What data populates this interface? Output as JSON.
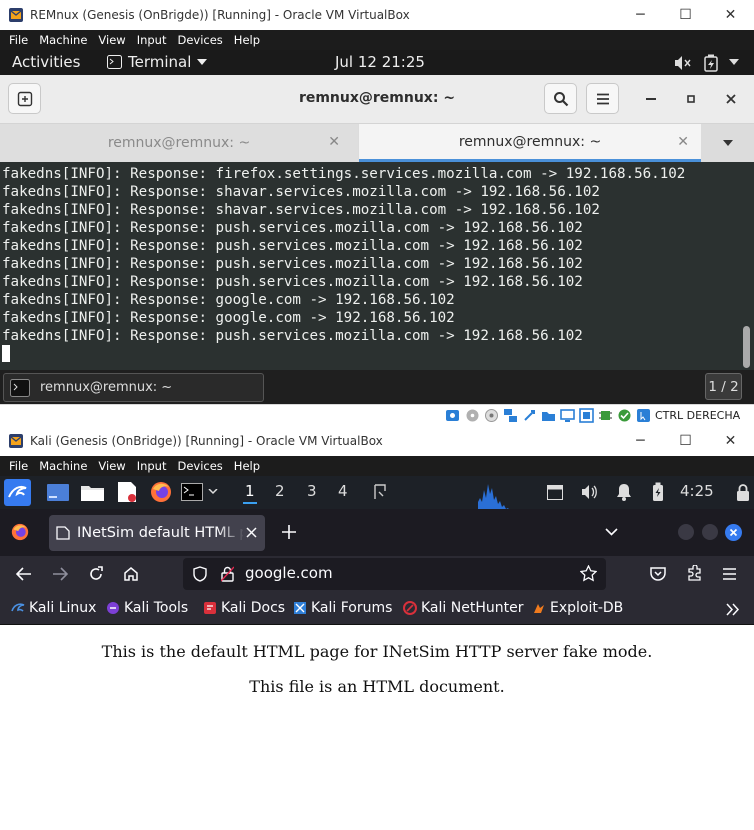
{
  "vm1": {
    "title": "REMnux (Genesis (OnBrigde)) [Running] - Oracle VM VirtualBox",
    "menu": [
      "File",
      "Machine",
      "View",
      "Input",
      "Devices",
      "Help"
    ],
    "gnome": {
      "activities": "Activities",
      "app": "Terminal",
      "clock": "Jul 12  21:25"
    },
    "terminal": {
      "window_title": "remnux@remnux: ~",
      "tabs": [
        {
          "label": "remnux@remnux: ~",
          "active": false
        },
        {
          "label": "remnux@remnux: ~",
          "active": true
        }
      ],
      "lines": [
        "fakedns[INFO]: Response: firefox.settings.services.mozilla.com -> 192.168.56.102",
        "fakedns[INFO]: Response: shavar.services.mozilla.com -> 192.168.56.102",
        "fakedns[INFO]: Response: shavar.services.mozilla.com -> 192.168.56.102",
        "fakedns[INFO]: Response: push.services.mozilla.com -> 192.168.56.102",
        "fakedns[INFO]: Response: push.services.mozilla.com -> 192.168.56.102",
        "fakedns[INFO]: Response: push.services.mozilla.com -> 192.168.56.102",
        "fakedns[INFO]: Response: push.services.mozilla.com -> 192.168.56.102",
        "fakedns[INFO]: Response: google.com -> 192.168.56.102",
        "fakedns[INFO]: Response: google.com -> 192.168.56.102",
        "fakedns[INFO]: Response: push.services.mozilla.com -> 192.168.56.102"
      ]
    },
    "taskbar": {
      "task_label": "remnux@remnux: ~",
      "page": "1 / 2"
    },
    "status": {
      "host_key": "CTRL DERECHA"
    }
  },
  "vm2": {
    "title": "Kali (Genesis (OnBridge)) [Running] - Oracle VM VirtualBox",
    "menu": [
      "File",
      "Machine",
      "View",
      "Input",
      "Devices",
      "Help"
    ],
    "panel": {
      "workspaces": [
        "1",
        "2",
        "3",
        "4"
      ],
      "clock": "4:25"
    },
    "firefox": {
      "tab_title": "INetSim default HTML page",
      "url": "google.com",
      "bookmarks": [
        "Kali Linux",
        "Kali Tools",
        "Kali Docs",
        "Kali Forums",
        "Kali NetHunter",
        "Exploit-DB"
      ]
    },
    "page": {
      "line1": "This is the default HTML page for INetSim HTTP server fake mode.",
      "line2": "This file is an HTML document."
    }
  },
  "colors": {
    "vbox_menu_bg": "#1c1c1c",
    "terminal_bg": "#2b3130",
    "tab_accent": "#4a90d9",
    "kali_blue": "#367bf0",
    "firefox_bg": "#2b2a33"
  }
}
